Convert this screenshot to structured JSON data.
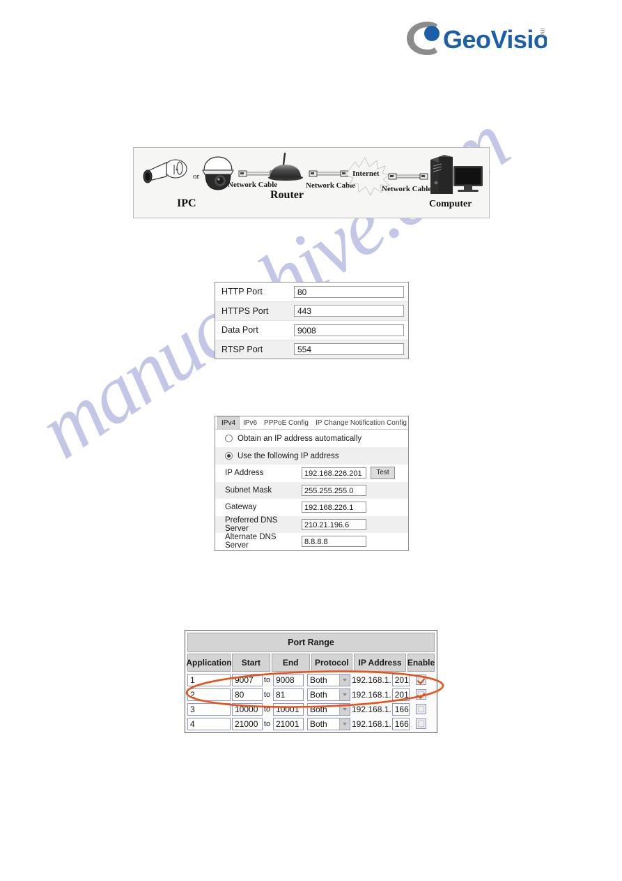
{
  "brand": {
    "name": "GeoVision",
    "suffix": "inc.",
    "logo_blue": "#1b5fa8",
    "logo_gray": "#8c8c8c"
  },
  "diagram": {
    "title": "network-topology",
    "labels": {
      "ipc": "IPC",
      "or": "or",
      "cable1": "Network Cable",
      "router": "Router",
      "cable2": "Network Cable",
      "internet": "Internet",
      "cable3": "Network Cable",
      "computer": "Computer"
    }
  },
  "port_settings": {
    "rows": [
      {
        "label": "HTTP Port",
        "value": "80"
      },
      {
        "label": "HTTPS Port",
        "value": "443"
      },
      {
        "label": "Data Port",
        "value": "9008"
      },
      {
        "label": "RTSP Port",
        "value": "554"
      }
    ]
  },
  "ip_config": {
    "tabs": [
      {
        "label": "IPv4",
        "active": true
      },
      {
        "label": "IPv6",
        "active": false
      },
      {
        "label": "PPPoE Config",
        "active": false
      },
      {
        "label": "IP Change Notification Config",
        "active": false
      }
    ],
    "radio_auto": "Obtain an IP address automatically",
    "radio_static": "Use the following IP address",
    "test_button": "Test",
    "fields": [
      {
        "label": "IP Address",
        "value": "192.168.226.201"
      },
      {
        "label": "Subnet Mask",
        "value": "255.255.255.0"
      },
      {
        "label": "Gateway",
        "value": "192.168.226.1"
      },
      {
        "label": "Preferred DNS Server",
        "value": "210.21.196.6"
      },
      {
        "label": "Alternate DNS Server",
        "value": "8.8.8.8"
      }
    ]
  },
  "port_range": {
    "title": "Port Range",
    "columns": {
      "application": "Application",
      "start": "Start",
      "end": "End",
      "protocol": "Protocol",
      "ip_address": "IP Address",
      "enable": "Enable"
    },
    "to_text": "to",
    "ip_prefix": "192.168.1.",
    "rows": [
      {
        "application": "1",
        "start": "9007",
        "end": "9008",
        "protocol": "Both",
        "octet": "201",
        "enabled": true
      },
      {
        "application": "2",
        "start": "80",
        "end": "81",
        "protocol": "Both",
        "octet": "201",
        "enabled": true
      },
      {
        "application": "3",
        "start": "10000",
        "end": "10001",
        "protocol": "Both",
        "octet": "166",
        "enabled": false
      },
      {
        "application": "4",
        "start": "21000",
        "end": "21001",
        "protocol": "Both",
        "octet": "166",
        "enabled": false
      }
    ]
  },
  "annotation": {
    "shape": "ellipse",
    "color": "#e8531c",
    "covers": "rows 1 and 2"
  },
  "watermark": {
    "text": "manualshive.com",
    "color": "#c3c6e6"
  }
}
